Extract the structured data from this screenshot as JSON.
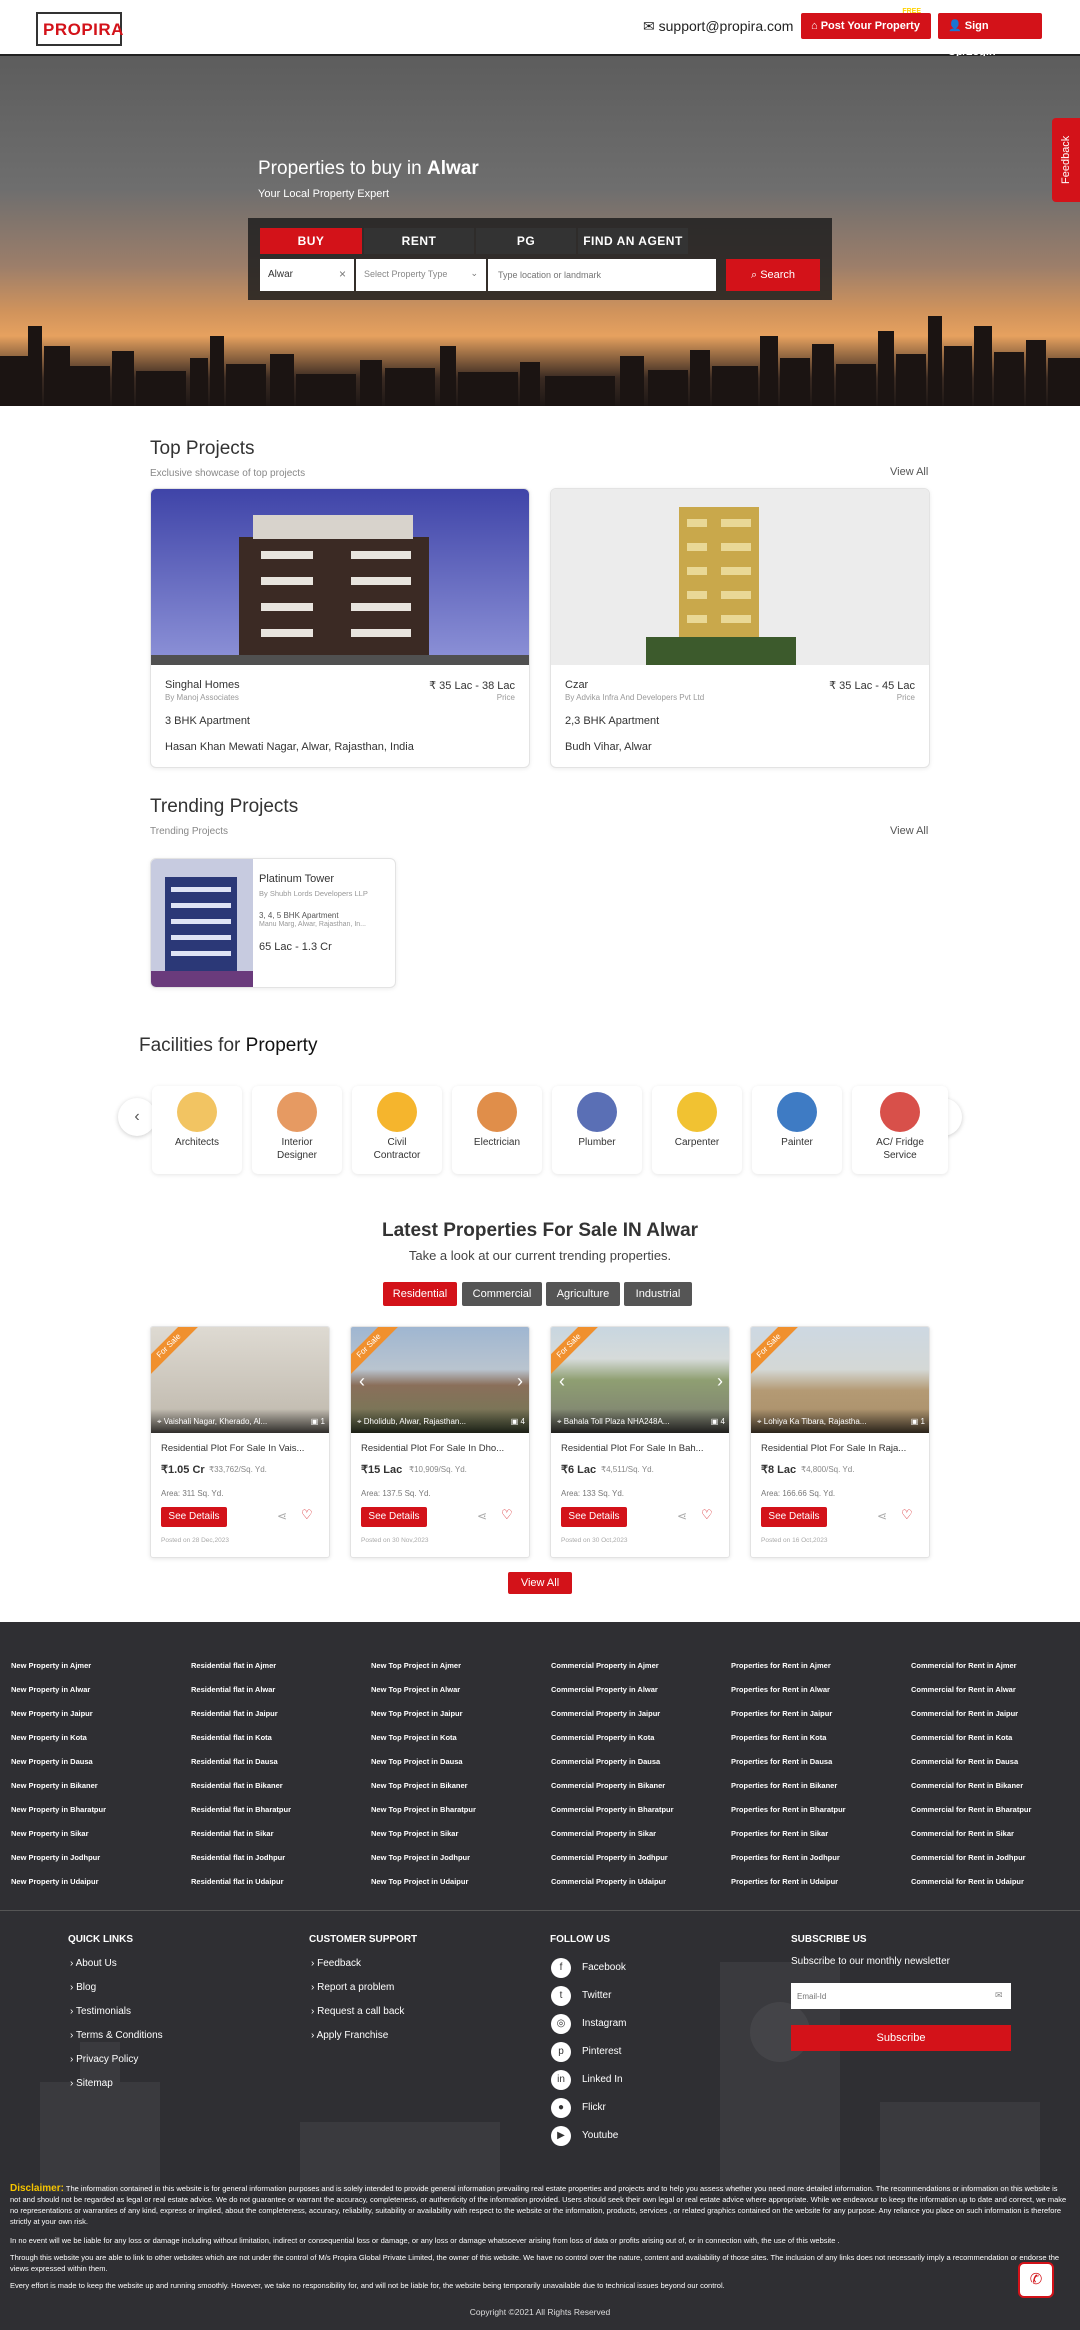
{
  "header": {
    "logo_text": "PROPIRA",
    "email": "support@propira.com",
    "post_property": "Post Your Property",
    "free_badge": "FREE",
    "signup": "Sign Up/Login"
  },
  "hero": {
    "title_prefix": "Properties to buy in",
    "city": "Alwar",
    "subtitle": "Your Local Property Expert",
    "tabs": [
      "BUY",
      "RENT",
      "PG",
      "FIND AN AGENT"
    ],
    "city_value": "Alwar",
    "property_type_placeholder": "Select Property Type",
    "location_placeholder": "Type location or landmark",
    "search_label": "Search",
    "feedback_label": "Feedback"
  },
  "top_projects": {
    "title": "Top Projects",
    "subtitle": "Exclusive showcase of top projects",
    "view_all": "View All",
    "items": [
      {
        "name": "Singhal Homes",
        "by": "By Manoj Associates",
        "price": "₹ 35 Lac - 38 Lac",
        "price_label": "Price",
        "config": "3 BHK Apartment",
        "address": "Hasan Khan Mewati Nagar, Alwar, Rajasthan, India"
      },
      {
        "name": "Czar",
        "by": "By Advika Infra And Developers Pvt Ltd",
        "price": "₹ 35 Lac - 45 Lac",
        "price_label": "Price",
        "config": "2,3 BHK Apartment",
        "address": "Budh Vihar, Alwar"
      }
    ]
  },
  "trending": {
    "title": "Trending Projects",
    "subtitle": "Trending Projects",
    "view_all": "View All",
    "item": {
      "name": "Platinum Tower",
      "by": "By Shubh Lords Developers LLP",
      "config": "3, 4, 5 BHK Apartment",
      "address": "Manu Marg, Alwar, Rajasthan, In...",
      "price": "65 Lac - 1.3 Cr"
    }
  },
  "facilities": {
    "title_prefix": "Facilities for",
    "title_bold": "Property",
    "items": [
      "Architects",
      "Interior Designer",
      "Civil Contractor",
      "Electrician",
      "Plumber",
      "Carpenter",
      "Painter",
      "AC/ Fridge Service"
    ]
  },
  "latest": {
    "title": "Latest Properties For Sale IN Alwar",
    "subtitle": "Take a look at our current trending properties.",
    "categories": [
      "Residential",
      "Commercial",
      "Agriculture",
      "Industrial"
    ],
    "tag": "For Sale",
    "details_label": "See Details",
    "view_all": "View All",
    "items": [
      {
        "location": "Vaishali Nagar, Kherado, Al...",
        "photos": "1",
        "title": "Residential Plot For Sale In Vais...",
        "price": "₹1.05 Cr",
        "sqprice": "₹33,762/Sq. Yd.",
        "area": "Area: 311 Sq. Yd.",
        "posted": "Posted on 28 Dec,2023"
      },
      {
        "location": "Dholidub, Alwar, Rajasthan...",
        "photos": "4",
        "title": "Residential Plot For Sale In Dho...",
        "price": "₹15 Lac",
        "sqprice": "₹10,909/Sq. Yd.",
        "area": "Area: 137.5 Sq. Yd.",
        "posted": "Posted on 30 Nov,2023"
      },
      {
        "location": "Bahala Toll Plaza NHA248A...",
        "photos": "4",
        "title": "Residential Plot For Sale In Bah...",
        "price": "₹6 Lac",
        "sqprice": "₹4,511/Sq. Yd.",
        "area": "Area: 133 Sq. Yd.",
        "posted": "Posted on 30 Oct,2023"
      },
      {
        "location": "Lohiya Ka Tibara, Rajastha...",
        "photos": "1",
        "title": "Residential Plot For Sale In Raja...",
        "price": "₹8 Lac",
        "sqprice": "₹4,800/Sq. Yd.",
        "area": "Area: 166.66 Sq. Yd.",
        "posted": "Posted on 16 Oct,2023"
      }
    ]
  },
  "city_links": {
    "cities": [
      "Ajmer",
      "Alwar",
      "Jaipur",
      "Kota",
      "Dausa",
      "Bikaner",
      "Bharatpur",
      "Sikar",
      "Jodhpur",
      "Udaipur"
    ],
    "columns": [
      [
        "New Property in Ajmer",
        "New Property in Alwar",
        "New Property in Jaipur",
        "New Property in Kota",
        "New Property in Dausa",
        "New Property in Bikaner",
        "New Property in Bharatpur",
        "New Property in Sikar",
        "New Property in Jodhpur",
        "New Property in Udaipur"
      ],
      [
        "Residential flat in Ajmer",
        "Residential flat in Alwar",
        "Residential flat in Jaipur",
        "Residential flat in Kota",
        "Residential flat in Dausa",
        "Residential flat in Bikaner",
        "Residential flat in Bharatpur",
        "Residential flat in Sikar",
        "Residential flat in Jodhpur",
        "Residential flat in Udaipur"
      ],
      [
        "New Top Project in Ajmer",
        "New Top Project in Alwar",
        "New Top Project in Jaipur",
        "New Top Project in Kota",
        "New Top Project in Dausa",
        "New Top Project in Bikaner",
        "New Top Project in Bharatpur",
        "New Top Project in Sikar",
        "New Top Project in Jodhpur",
        "New Top Project in Udaipur"
      ],
      [
        "Commercial Property in Ajmer",
        "Commercial Property in Alwar",
        "Commercial Property in Jaipur",
        "Commercial Property in Kota",
        "Commercial Property in Dausa",
        "Commercial Property in Bikaner",
        "Commercial Property in Bharatpur",
        "Commercial Property in Sikar",
        "Commercial Property in Jodhpur",
        "Commercial Property in Udaipur"
      ],
      [
        "Properties for Rent in Ajmer",
        "Properties for Rent in Alwar",
        "Properties for Rent in Jaipur",
        "Properties for Rent in Kota",
        "Properties for Rent in Dausa",
        "Properties for Rent in Bikaner",
        "Properties for Rent in Bharatpur",
        "Properties for Rent in Sikar",
        "Properties for Rent in Jodhpur",
        "Properties for Rent in Udaipur"
      ],
      [
        "Commercial for Rent in Ajmer",
        "Commercial for Rent in Alwar",
        "Commercial for Rent in Jaipur",
        "Commercial for Rent in Kota",
        "Commercial for Rent in Dausa",
        "Commercial for Rent in Bikaner",
        "Commercial for Rent in Bharatpur",
        "Commercial for Rent in Sikar",
        "Commercial for Rent in Jodhpur",
        "Commercial for Rent in Udaipur"
      ]
    ]
  },
  "footer": {
    "quick_links_title": "QUICK LINKS",
    "quick_links": [
      "About Us",
      "Blog",
      "Testimonials",
      "Terms & Conditions",
      "Privacy Policy",
      "Sitemap"
    ],
    "support_title": "CUSTOMER SUPPORT",
    "support_links": [
      "Feedback",
      "Report a problem",
      "Request a call back",
      "Apply Franchise"
    ],
    "follow_title": "FOLLOW US",
    "social": [
      "Facebook",
      "Twitter",
      "Instagram",
      "Pinterest",
      "Linked In",
      "Flickr",
      "Youtube"
    ],
    "subscribe_title": "SUBSCRIBE US",
    "subscribe_text": "Subscribe to our monthly newsletter",
    "email_placeholder": "Email-Id",
    "subscribe_button": "Subscribe",
    "disclaimer_label": "Disclaimer:",
    "disclaimer_1": "The information contained in this website is for general information purposes and is solely intended to provide general information prevailing real estate properties and projects and to help you assess whether you need more detailed information. The recommendations or information on this website is not and should not be regarded as legal or real estate advice. We do not guarantee or warrant the accuracy, completeness, or authenticity of the information provided. Users should seek their own legal or real estate advice where appropriate. While we endeavour to keep the information up to date and correct, we make no representations or warranties of any kind, express or implied, about the completeness, accuracy, reliability, suitability or availability with respect to the website or the information, products, services , or related graphics contained on the website for any purpose. Any reliance you place on such information is therefore strictly at your own risk.",
    "disclaimer_2": "In no event will we be liable for any loss or damage including without limitation, indirect or consequential loss or damage, or any loss or damage whatsoever arising from loss of data or profits arising out of, or in connection with, the use of this website .",
    "disclaimer_3": "Through this website you are able to link to other websites which are not under the control of M/s Propira Global Private Limited, the owner of this website. We have no control over the nature, content and availability of those sites. The inclusion of any links does not necessarily imply a recommendation or endorse the views expressed within them.",
    "disclaimer_4": "Every effort is made to keep the website up and running smoothly. However, we take no responsibility for, and will not be liable for, the website being temporarily unavailable due to technical issues beyond our control.",
    "copyright": "Copyright ©2021 All Rights Reserved"
  }
}
